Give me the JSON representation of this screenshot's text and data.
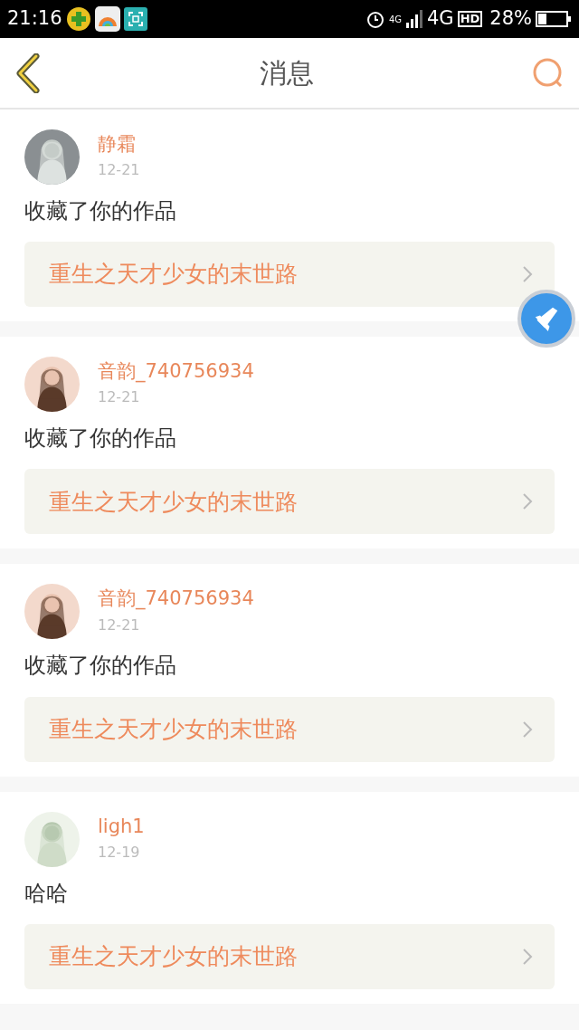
{
  "status_bar": {
    "time": "21:16",
    "network_small": "4G",
    "network": "4G",
    "hd": "HD",
    "battery": "28%"
  },
  "header": {
    "title": "消息"
  },
  "messages": [
    {
      "user": "静霜",
      "date": "12-21",
      "action": "收藏了你的作品",
      "work": "重生之天才少女的末世路"
    },
    {
      "user": "音韵_740756934",
      "date": "12-21",
      "action": "收藏了你的作品",
      "work": "重生之天才少女的末世路"
    },
    {
      "user": "音韵_740756934",
      "date": "12-21",
      "action": "收藏了你的作品",
      "work": "重生之天才少女的末世路"
    },
    {
      "user": "ligh1",
      "date": "12-19",
      "action": "哈哈",
      "work": "重生之天才少女的末世路"
    }
  ]
}
